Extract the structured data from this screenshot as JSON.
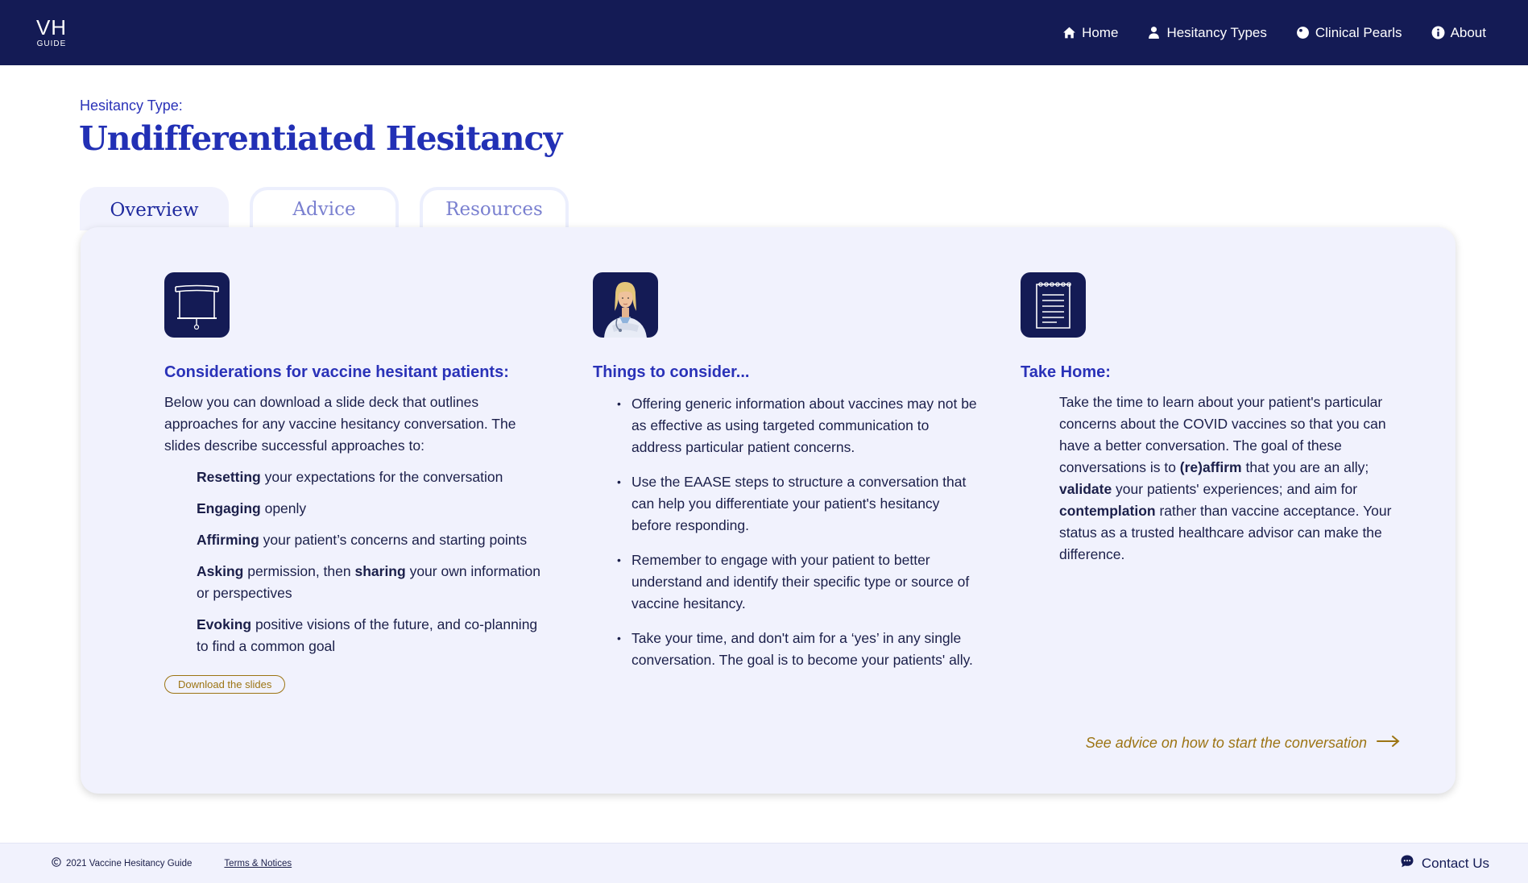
{
  "header": {
    "logo_main": "VH",
    "logo_sub": "GUIDE",
    "nav": [
      {
        "label": "Home",
        "icon": "home-icon"
      },
      {
        "label": "Hesitancy Types",
        "icon": "person-icon"
      },
      {
        "label": "Clinical Pearls",
        "icon": "pearl-icon"
      },
      {
        "label": "About",
        "icon": "info-icon"
      }
    ]
  },
  "page": {
    "eyebrow": "Hesitancy Type:",
    "title": "Undifferentiated Hesitancy"
  },
  "tabs": [
    {
      "label": "Overview",
      "active": true
    },
    {
      "label": "Advice",
      "active": false
    },
    {
      "label": "Resources",
      "active": false
    }
  ],
  "columns": {
    "considerations": {
      "icon": "projection-screen-icon",
      "title": "Considerations for vaccine hesitant patients:",
      "intro": "Below you can download a slide deck that outlines approaches for any vaccine hesitancy conversation. The slides describe successful approaches to:",
      "approaches": [
        {
          "bold": "Resetting",
          "rest": " your expectations for the conversation"
        },
        {
          "bold": "Engaging",
          "rest": " openly"
        },
        {
          "bold": "Affirming",
          "rest": " your patient’s concerns and starting points"
        },
        {
          "bold": "Asking",
          "mid": " permission, then ",
          "bold2": "sharing",
          "rest": " your own information or perspectives"
        },
        {
          "bold": "Evoking",
          "rest": " positive visions of the future, and co-planning to find a common goal"
        }
      ],
      "download_label": "Download the slides"
    },
    "things": {
      "icon": "doctor-icon",
      "title": "Things to consider...",
      "bullets": [
        "Offering generic information about vaccines may not be as effective as using targeted communication to address particular patient concerns.",
        "Use the EAASE steps to structure a conversation that can help you differentiate your patient's hesitancy before responding.",
        "Remember to engage with your patient to better understand and identify their specific type or source of vaccine hesitancy.",
        "Take your time, and don't aim for a ‘yes’ in any single conversation. The goal is to become your patients' ally."
      ]
    },
    "takehome": {
      "icon": "notepad-icon",
      "title": "Take Home:",
      "p1": "Take the time to learn about your patient's particular concerns about the COVID vaccines so that you can have a better conversation. The goal of these conversations is to ",
      "b1": "(re)affirm",
      "p2": " that you are an ally; ",
      "b2": "validate",
      "p3": " your patients' experiences; and aim for ",
      "b3": "contemplation",
      "p4": " rather than vaccine acceptance. Your status as a trusted healthcare advisor can make the difference."
    }
  },
  "advice_link": "See advice on how to start the conversation",
  "footer": {
    "copyright": "2021 Vaccine Hesitancy Guide",
    "terms": "Terms & Notices",
    "contact": "Contact Us"
  },
  "colors": {
    "navy": "#141b55",
    "accent_blue": "#2a32b8",
    "gold": "#9c7413",
    "panel_bg": "#f1f2fd"
  }
}
